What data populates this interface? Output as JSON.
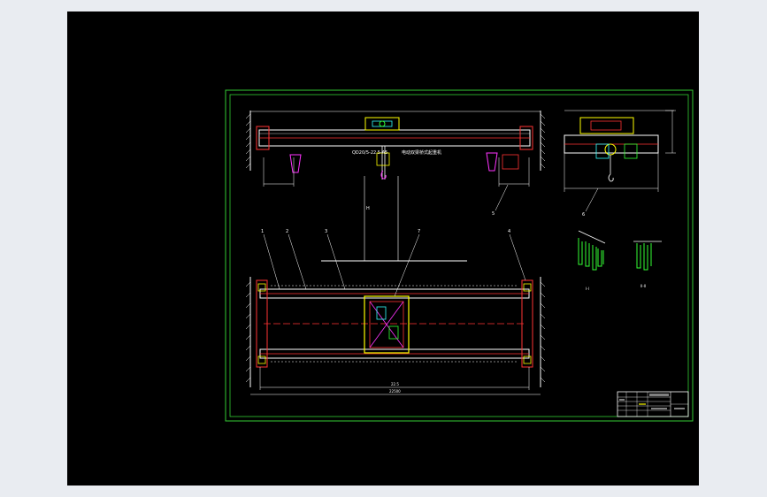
{
  "colors": {
    "page_background": "#e9ecf1",
    "viewport_background": "#000000",
    "frame": "#33cc33",
    "white": "#ffffff",
    "red": "#ff3333",
    "yellow": "#ffff00",
    "magenta": "#ff33ff",
    "cyan": "#33ffff",
    "green": "#33ff33"
  },
  "drawing": {
    "main_title": "电动双梁桥式起重机",
    "model_label": "QD20/5-22.5-A5",
    "callouts": [
      "1",
      "2",
      "3",
      "4",
      "5",
      "6",
      "7"
    ],
    "span_dimension": "22500",
    "wheelbase_dimension": "22.5",
    "height_dimension": "H",
    "detail_labels": [
      "I-I",
      "II-II"
    ],
    "title_block_rows": [
      "",
      "",
      "",
      "",
      ""
    ]
  }
}
